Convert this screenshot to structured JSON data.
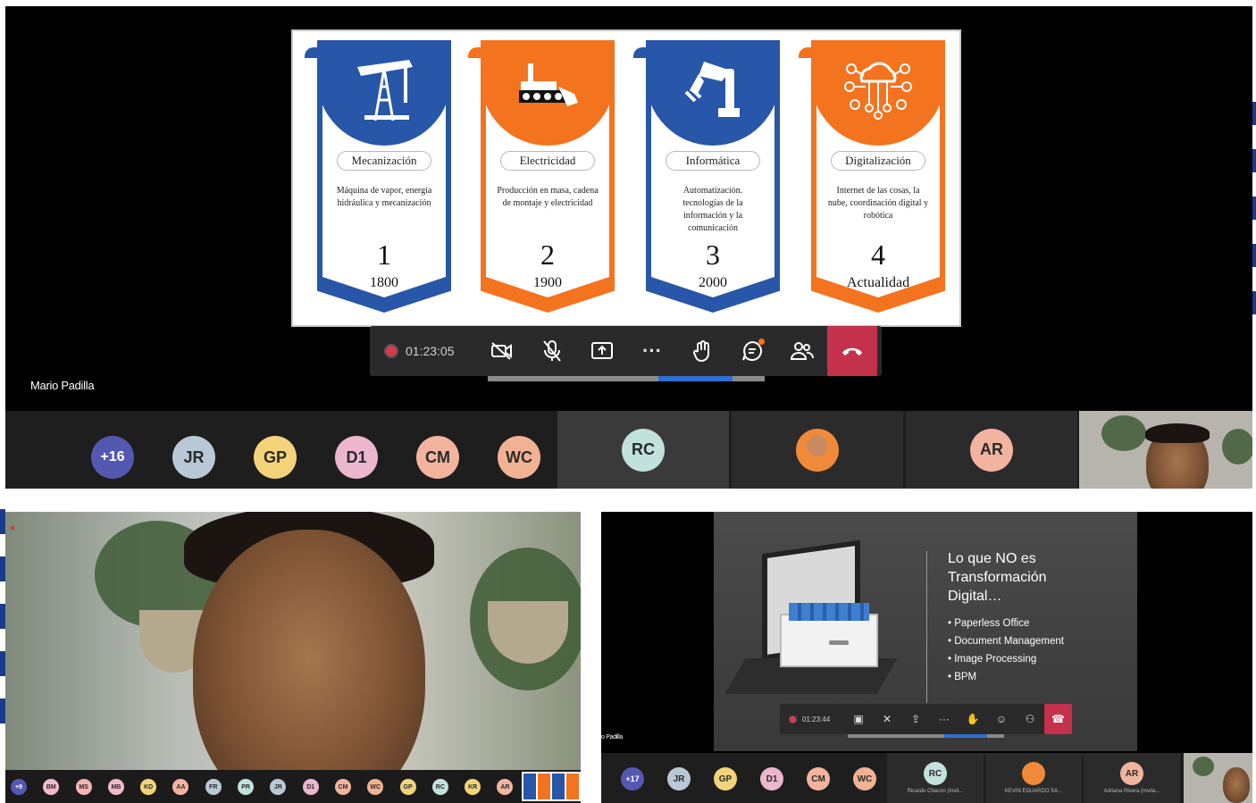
{
  "top_meeting": {
    "slide": {
      "cards": [
        {
          "title": "Mecanización",
          "desc": "Máquina de vapor, energía hidráulica y mecanización",
          "number": "1",
          "year": "1800",
          "color": "blue",
          "icon": "oil-pump-icon"
        },
        {
          "title": "Electricidad",
          "desc": "Producción en masa, cadena de montaje y electricidad",
          "number": "2",
          "year": "1900",
          "color": "orange",
          "icon": "assembly-line-icon"
        },
        {
          "title": "Informática",
          "desc": "Automatización. tecnologías de la información y la comunicación",
          "number": "3",
          "year": "2000",
          "color": "blue",
          "icon": "robot-arm-icon"
        },
        {
          "title": "Digitalización",
          "desc": "Internet de las cosas, la nube, coordinación digital y robótica",
          "number": "4",
          "year": "Actualidad",
          "color": "orange",
          "icon": "cloud-network-icon"
        }
      ]
    },
    "controls": {
      "timer": "01:23:05"
    },
    "presenter_name": "Mario Padilla",
    "participants": {
      "overflow": "+16",
      "avatars": [
        {
          "initials": "JR",
          "color": "#b8c8d6"
        },
        {
          "initials": "GP",
          "color": "#f3d37a"
        },
        {
          "initials": "D1",
          "color": "#ecb6cf"
        },
        {
          "initials": "CM",
          "color": "#f3b49f"
        },
        {
          "initials": "WC",
          "color": "#f1b293"
        }
      ],
      "tiles": [
        {
          "initials": "RC",
          "color": "#c1e1dd"
        },
        {
          "initials": "",
          "color": "#f08a3a",
          "photo": true
        },
        {
          "initials": "AR",
          "color": "#f3b49f"
        }
      ]
    }
  },
  "bottom_left": {
    "participants": [
      "+9",
      "BM",
      "MS",
      "MB",
      "KD",
      "AA",
      "FR",
      "PR",
      "JR",
      "D1",
      "CM",
      "WC",
      "GP",
      "RC",
      "KR",
      "AR"
    ]
  },
  "bottom_right": {
    "slide_title": "Lo que NO es Transformación Digital…",
    "bullets": [
      "Paperless Office",
      "Document Management",
      "Image Processing",
      "BPM"
    ],
    "timer": "01:23:44",
    "presenter_name": "o Padilla",
    "participants": {
      "overflow": "+17",
      "avatars": [
        "JR",
        "GP",
        "D1",
        "CM",
        "WC"
      ],
      "tiles": [
        {
          "initials": "RC",
          "name": "Ricardo Chacón (Invit..."
        },
        {
          "initials": "",
          "name": "KEVIN EDUARDO SA..."
        },
        {
          "initials": "AR",
          "name": "Adriana Rivera (Invita..."
        }
      ]
    }
  },
  "colors": {
    "blue": "#2856a8",
    "orange": "#f4731f",
    "hangup": "#c4314b",
    "record": "#d73a4a",
    "overflow_avatar": "#5558af"
  }
}
